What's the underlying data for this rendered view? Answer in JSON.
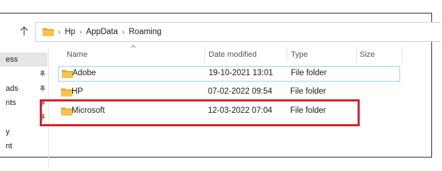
{
  "address": {
    "breadcrumb": [
      "Hp",
      "AppData",
      "Roaming"
    ]
  },
  "sidebar": {
    "items": [
      {
        "label": "ess",
        "selected": true,
        "pinned": false
      },
      {
        "label": "",
        "selected": false,
        "pinned": true
      },
      {
        "label": "ads",
        "selected": false,
        "pinned": true
      },
      {
        "label": "nts",
        "selected": false,
        "pinned": true
      },
      {
        "label": "",
        "selected": false,
        "pinned": true
      },
      {
        "label": "y",
        "selected": false,
        "pinned": false
      },
      {
        "label": "nt",
        "selected": false,
        "pinned": false
      }
    ]
  },
  "columns": {
    "name": "Name",
    "date": "Date modified",
    "type": "Type",
    "size": "Size"
  },
  "rows": [
    {
      "name": "Adobe",
      "date": "19-10-2021 13:01",
      "type": "File folder",
      "size": "",
      "selected": true
    },
    {
      "name": "HP",
      "date": "07-02-2022 09:54",
      "type": "File folder",
      "size": "",
      "selected": false
    },
    {
      "name": "Microsoft",
      "date": "12-03-2022 07:04",
      "type": "File folder",
      "size": "",
      "selected": false,
      "highlighted": true
    }
  ],
  "colors": {
    "folder": "#f5c44a",
    "folder_dark": "#e0a92c",
    "highlight": "#d81f26",
    "selection_border": "#99d1ff"
  }
}
